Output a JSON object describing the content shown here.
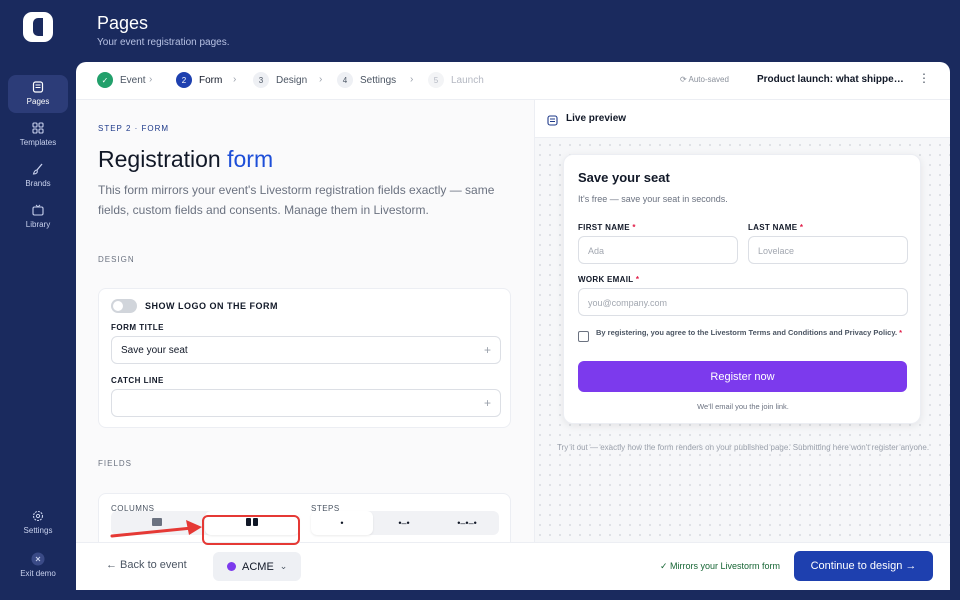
{
  "rail": {
    "items": [
      {
        "label": "Pages",
        "icon": "pages-icon",
        "active": true
      },
      {
        "label": "Templates",
        "icon": "grid-icon"
      },
      {
        "label": "Brands",
        "icon": "brush-icon"
      },
      {
        "label": "Library",
        "icon": "library-icon"
      }
    ],
    "bottom": [
      {
        "label": "Settings",
        "icon": "gear-icon"
      },
      {
        "label": "Exit demo",
        "icon": "exit-icon"
      }
    ]
  },
  "header": {
    "title": "Pages",
    "subtitle": "Your event registration pages."
  },
  "stepper": {
    "steps": [
      {
        "num": "✓",
        "label": "Event",
        "state": "done"
      },
      {
        "num": "2",
        "label": "Form",
        "state": "current"
      },
      {
        "num": "3",
        "label": "Design",
        "state": "todo"
      },
      {
        "num": "4",
        "label": "Settings",
        "state": "todo"
      },
      {
        "num": "5",
        "label": "Launch",
        "state": "disabled"
      }
    ],
    "autosaved": "Auto-saved",
    "doc_title": "Product launch: what shipped this quarter"
  },
  "form": {
    "eyebrow": "STEP 2 · FORM",
    "title_main": "Registration",
    "title_accent": "form",
    "description": "This form mirrors your event's Livestorm registration fields exactly — same fields, custom fields and consents. Manage them in Livestorm.",
    "design_label": "DESIGN",
    "show_logo_label": "SHOW LOGO ON THE FORM",
    "form_title_label": "FORM TITLE",
    "form_title_value": "Save your seat",
    "catch_line_label": "CATCH LINE",
    "catch_line_value": "",
    "fields_label": "FIELDS",
    "columns_label": "COLUMNS",
    "steps_label": "STEPS"
  },
  "preview": {
    "header": "Live preview",
    "title": "Save your seat",
    "subtitle": "It's free — save your seat in seconds.",
    "first_name_label": "FIRST NAME",
    "first_name_placeholder": "Ada",
    "last_name_label": "LAST NAME",
    "last_name_placeholder": "Lovelace",
    "email_label": "WORK EMAIL",
    "email_placeholder": "you@company.com",
    "consent": "By registering, you agree to the Livestorm Terms and Conditions and Privacy Policy.",
    "required_mark": "*",
    "button": "Register now",
    "foot": "We'll email you the join link.",
    "note": "Try it out — exactly how the form renders on your published page. Submitting here won't register anyone."
  },
  "bottom": {
    "back": "← Back to event",
    "brand": "ACME",
    "mirrors": "✓ Mirrors your Livestorm form",
    "continue": "Continue to design →"
  },
  "colors": {
    "accent": "#1e40af",
    "brand": "#7c3aed",
    "rail": "#1a2a5e",
    "highlight": "#e53935"
  }
}
